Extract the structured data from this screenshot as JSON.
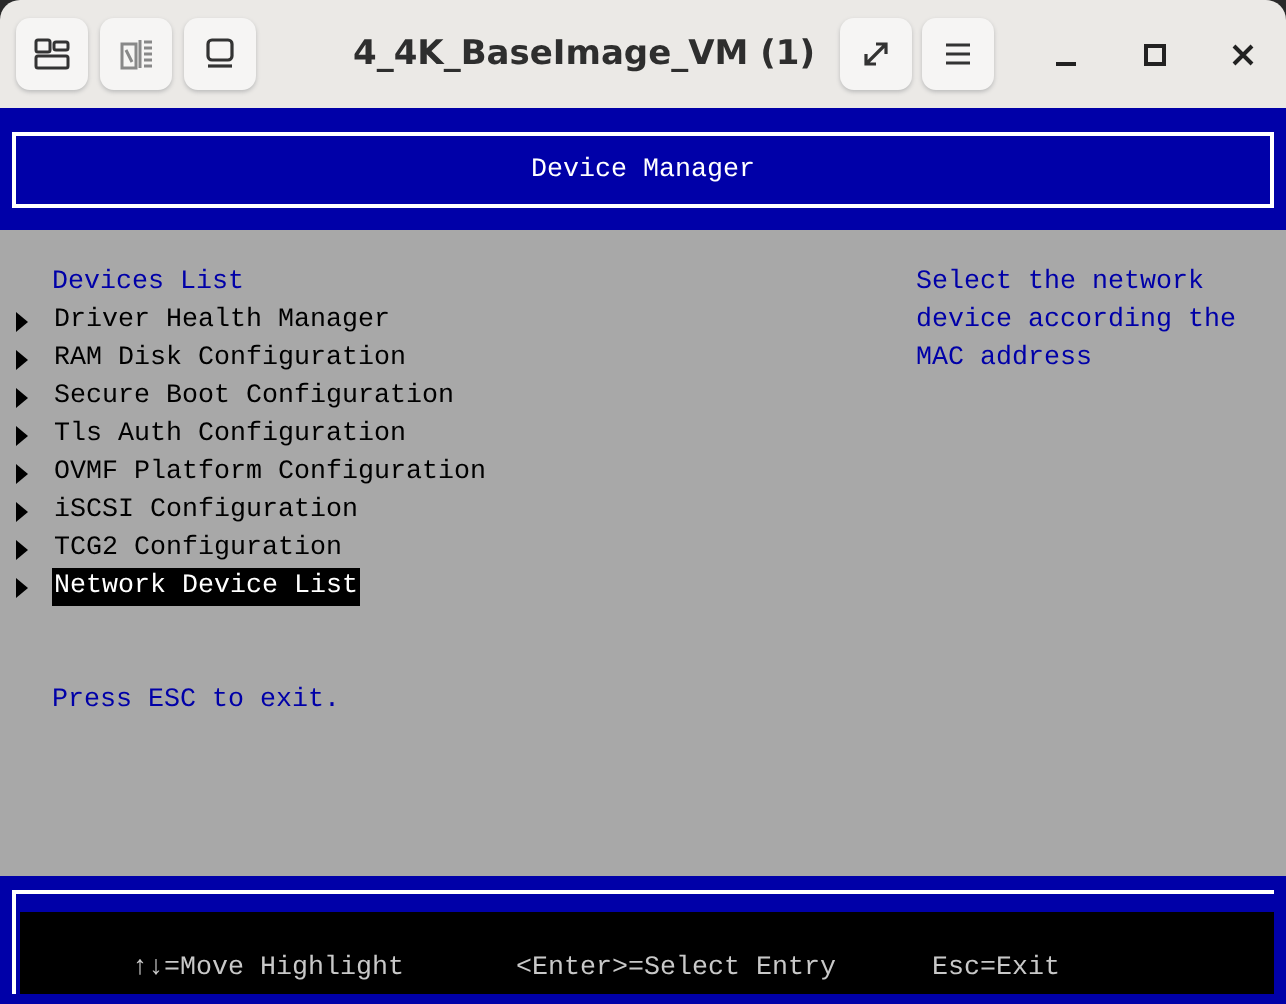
{
  "window": {
    "title": "4_4K_BaseImage_VM (1)"
  },
  "header": {
    "title": "Device Manager"
  },
  "menu": {
    "heading": "Devices List",
    "items": [
      {
        "label": "Driver Health Manager",
        "selected": false
      },
      {
        "label": "RAM Disk Configuration",
        "selected": false
      },
      {
        "label": "Secure Boot Configuration",
        "selected": false
      },
      {
        "label": "Tls Auth Configuration",
        "selected": false
      },
      {
        "label": "OVMF Platform Configuration",
        "selected": false
      },
      {
        "label": "iSCSI Configuration",
        "selected": false
      },
      {
        "label": "TCG2 Configuration",
        "selected": false
      },
      {
        "label": "Network Device List",
        "selected": true
      }
    ]
  },
  "help": {
    "text": "Select the network device according the MAC address"
  },
  "exit_hint": "Press ESC to exit.",
  "footer": {
    "hints": [
      "↑↓=Move Highlight",
      "<Enter>=Select Entry",
      "Esc=Exit"
    ]
  }
}
